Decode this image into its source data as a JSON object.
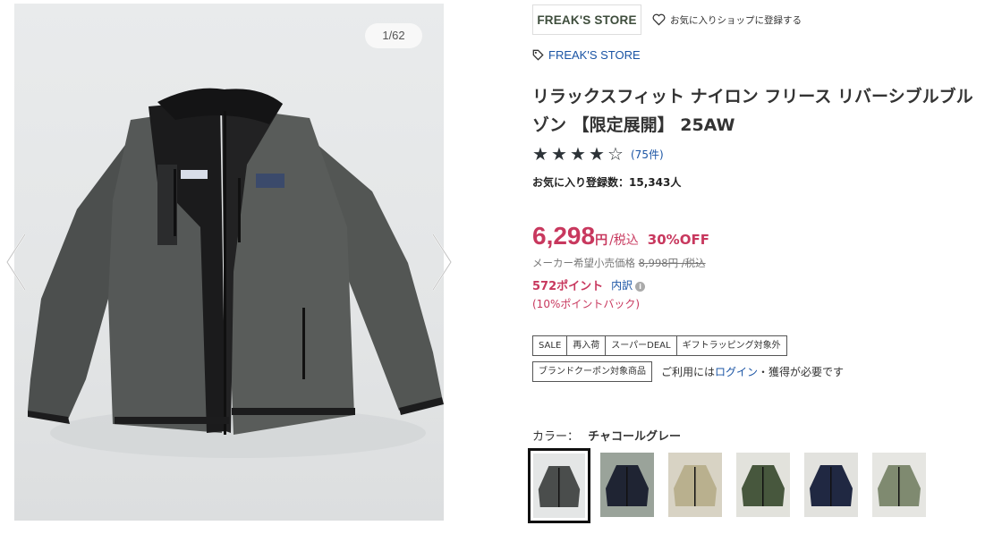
{
  "gallery": {
    "counter": "1/62"
  },
  "shop": {
    "logo_text": "FREAK'S STORE",
    "favorite_label": "お気に入りショップに登録する"
  },
  "brand": {
    "name": "FREAK'S STORE"
  },
  "product": {
    "title": "リラックスフィット ナイロン フリース リバーシブルブルゾン 【限定展開】 25AW",
    "rating_stars": 4,
    "rating_max": 5,
    "review_count": "(75件)",
    "favorite_count_label": "お気に入り登録数：",
    "favorite_count_value": "15,343人"
  },
  "price": {
    "value": "6,298",
    "yen": "円",
    "tax": "/税込",
    "discount": "30%OFF",
    "msrp_label": "メーカー希望小売価格",
    "msrp_value": "8,998円 /税込"
  },
  "points": {
    "value": "572ポイント",
    "breakdown_label": "内訳",
    "back_label": "(10%ポイントバック)"
  },
  "tags": [
    "SALE",
    "再入荷",
    "スーパーDEAL",
    "ギフトラッピング対象外"
  ],
  "coupon": {
    "tag": "ブランドクーポン対象商品",
    "note_prefix": "ご利用には",
    "login_link": "ログイン",
    "note_suffix": "・獲得が必要です"
  },
  "color": {
    "label": "カラー：",
    "value": "チャコールグレー",
    "swatches": [
      {
        "name": "charcoal-grey",
        "selected": true,
        "bg": "#e4e6e6",
        "main": "#4a4d4c"
      },
      {
        "name": "navy-model",
        "selected": false,
        "bg": "#9aa39a",
        "main": "#1f2433"
      },
      {
        "name": "beige-olive",
        "selected": false,
        "bg": "#d8d3c4",
        "main": "#b9b08e"
      },
      {
        "name": "olive-brown",
        "selected": false,
        "bg": "#e2e2dc",
        "main": "#47573d"
      },
      {
        "name": "navy-beige",
        "selected": false,
        "bg": "#e2e2de",
        "main": "#202842"
      },
      {
        "name": "khaki-black",
        "selected": false,
        "bg": "#e6e6e2",
        "main": "#7f8a70"
      }
    ]
  },
  "theme": {
    "price_color": "#c8385e",
    "link_color": "#1a54a4",
    "star_color": "#2d3338"
  }
}
